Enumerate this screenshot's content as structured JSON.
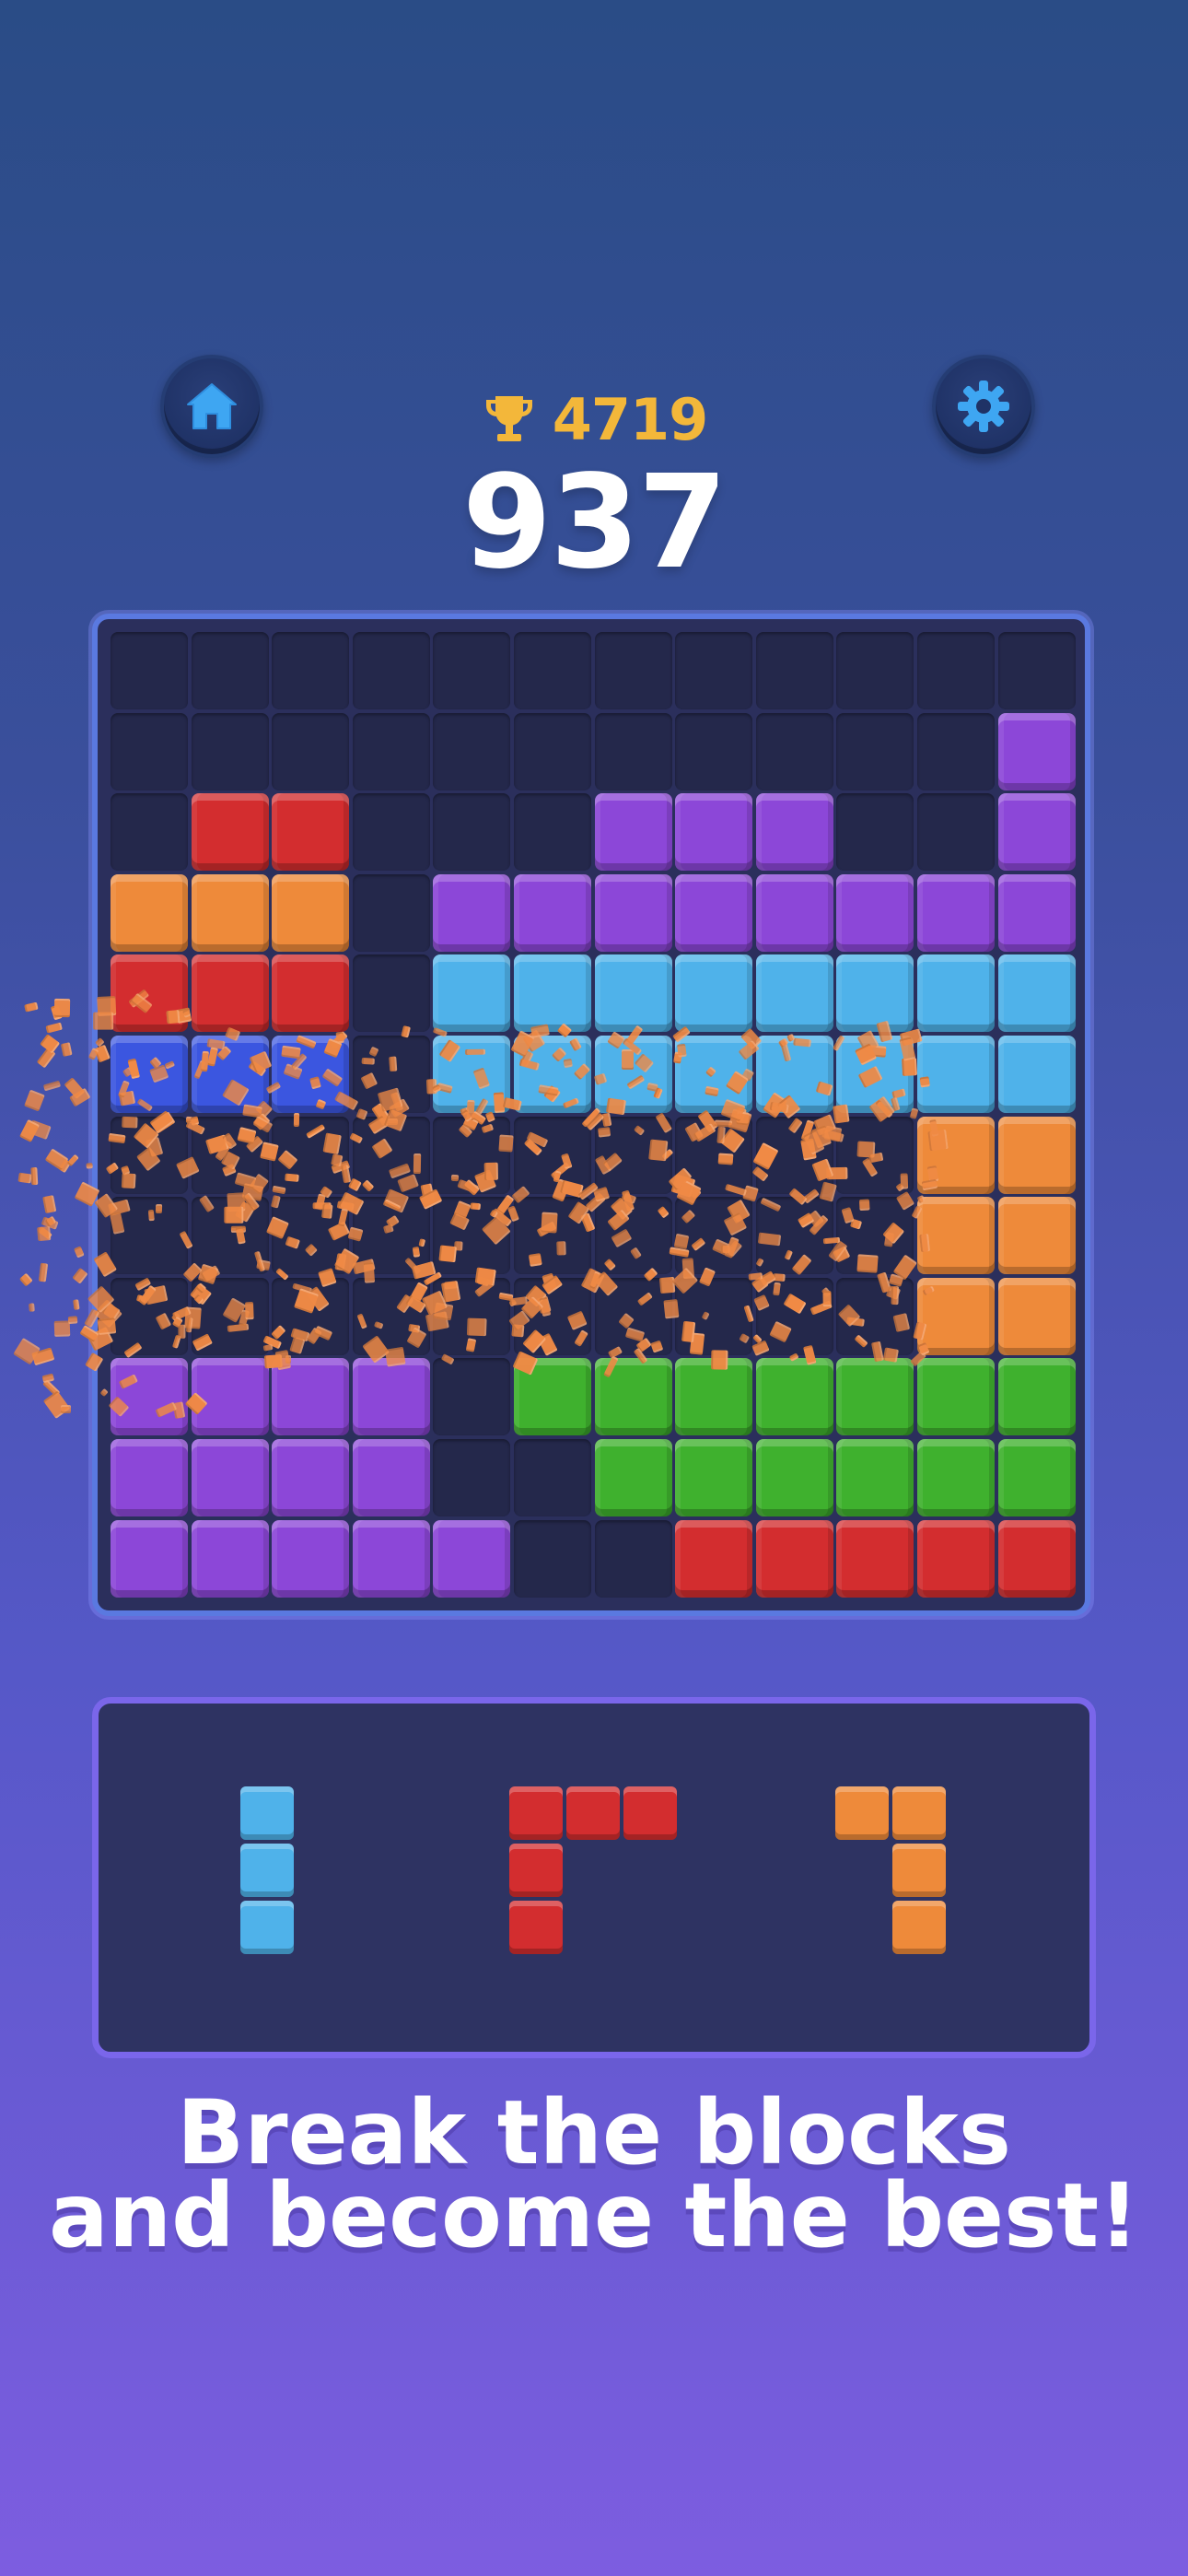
{
  "header": {
    "best_score": "4719",
    "score": "937",
    "home_icon": "home-icon",
    "settings_icon": "gear-icon",
    "trophy_icon": "trophy-icon"
  },
  "colors": {
    "P": "#8c47d8",
    "R": "#d32d2f",
    "O": "#ee8a3a",
    "C": "#4fb2ea",
    "B": "#3b56e0",
    "G": "#3fb12e",
    "shard": "#f08a45",
    "gold": "#f3b73a"
  },
  "board": {
    "rows": 12,
    "cols": 12,
    "grid": [
      "............",
      "...........P",
      ".RR...PPP..PP",
      "OOO.PPPPPPPP",
      "RRR.CCCCCCCC",
      "BBB.CCCCCCCC",
      "..........OO",
      "..........OO",
      "..........OO",
      "PPPP.GGGGGGG",
      "PPPP..GGGGGG",
      "PPPPP..RRRRR"
    ],
    "effect": "orange block shatter across rows 7 to 9"
  },
  "tray": {
    "pieces": [
      {
        "name": "piece-cyan-i3",
        "color": "C",
        "cells": [
          [
            0,
            0
          ],
          [
            0,
            1
          ],
          [
            0,
            2
          ]
        ]
      },
      {
        "name": "piece-red-l",
        "color": "R",
        "cells": [
          [
            0,
            0
          ],
          [
            1,
            0
          ],
          [
            2,
            0
          ],
          [
            0,
            1
          ],
          [
            0,
            2
          ]
        ]
      },
      {
        "name": "piece-orange-l",
        "color": "O",
        "cells": [
          [
            0,
            0
          ],
          [
            1,
            0
          ],
          [
            1,
            1
          ],
          [
            1,
            2
          ]
        ]
      }
    ]
  },
  "tagline": {
    "line1": "Break the blocks",
    "line2": "and become the best!"
  }
}
